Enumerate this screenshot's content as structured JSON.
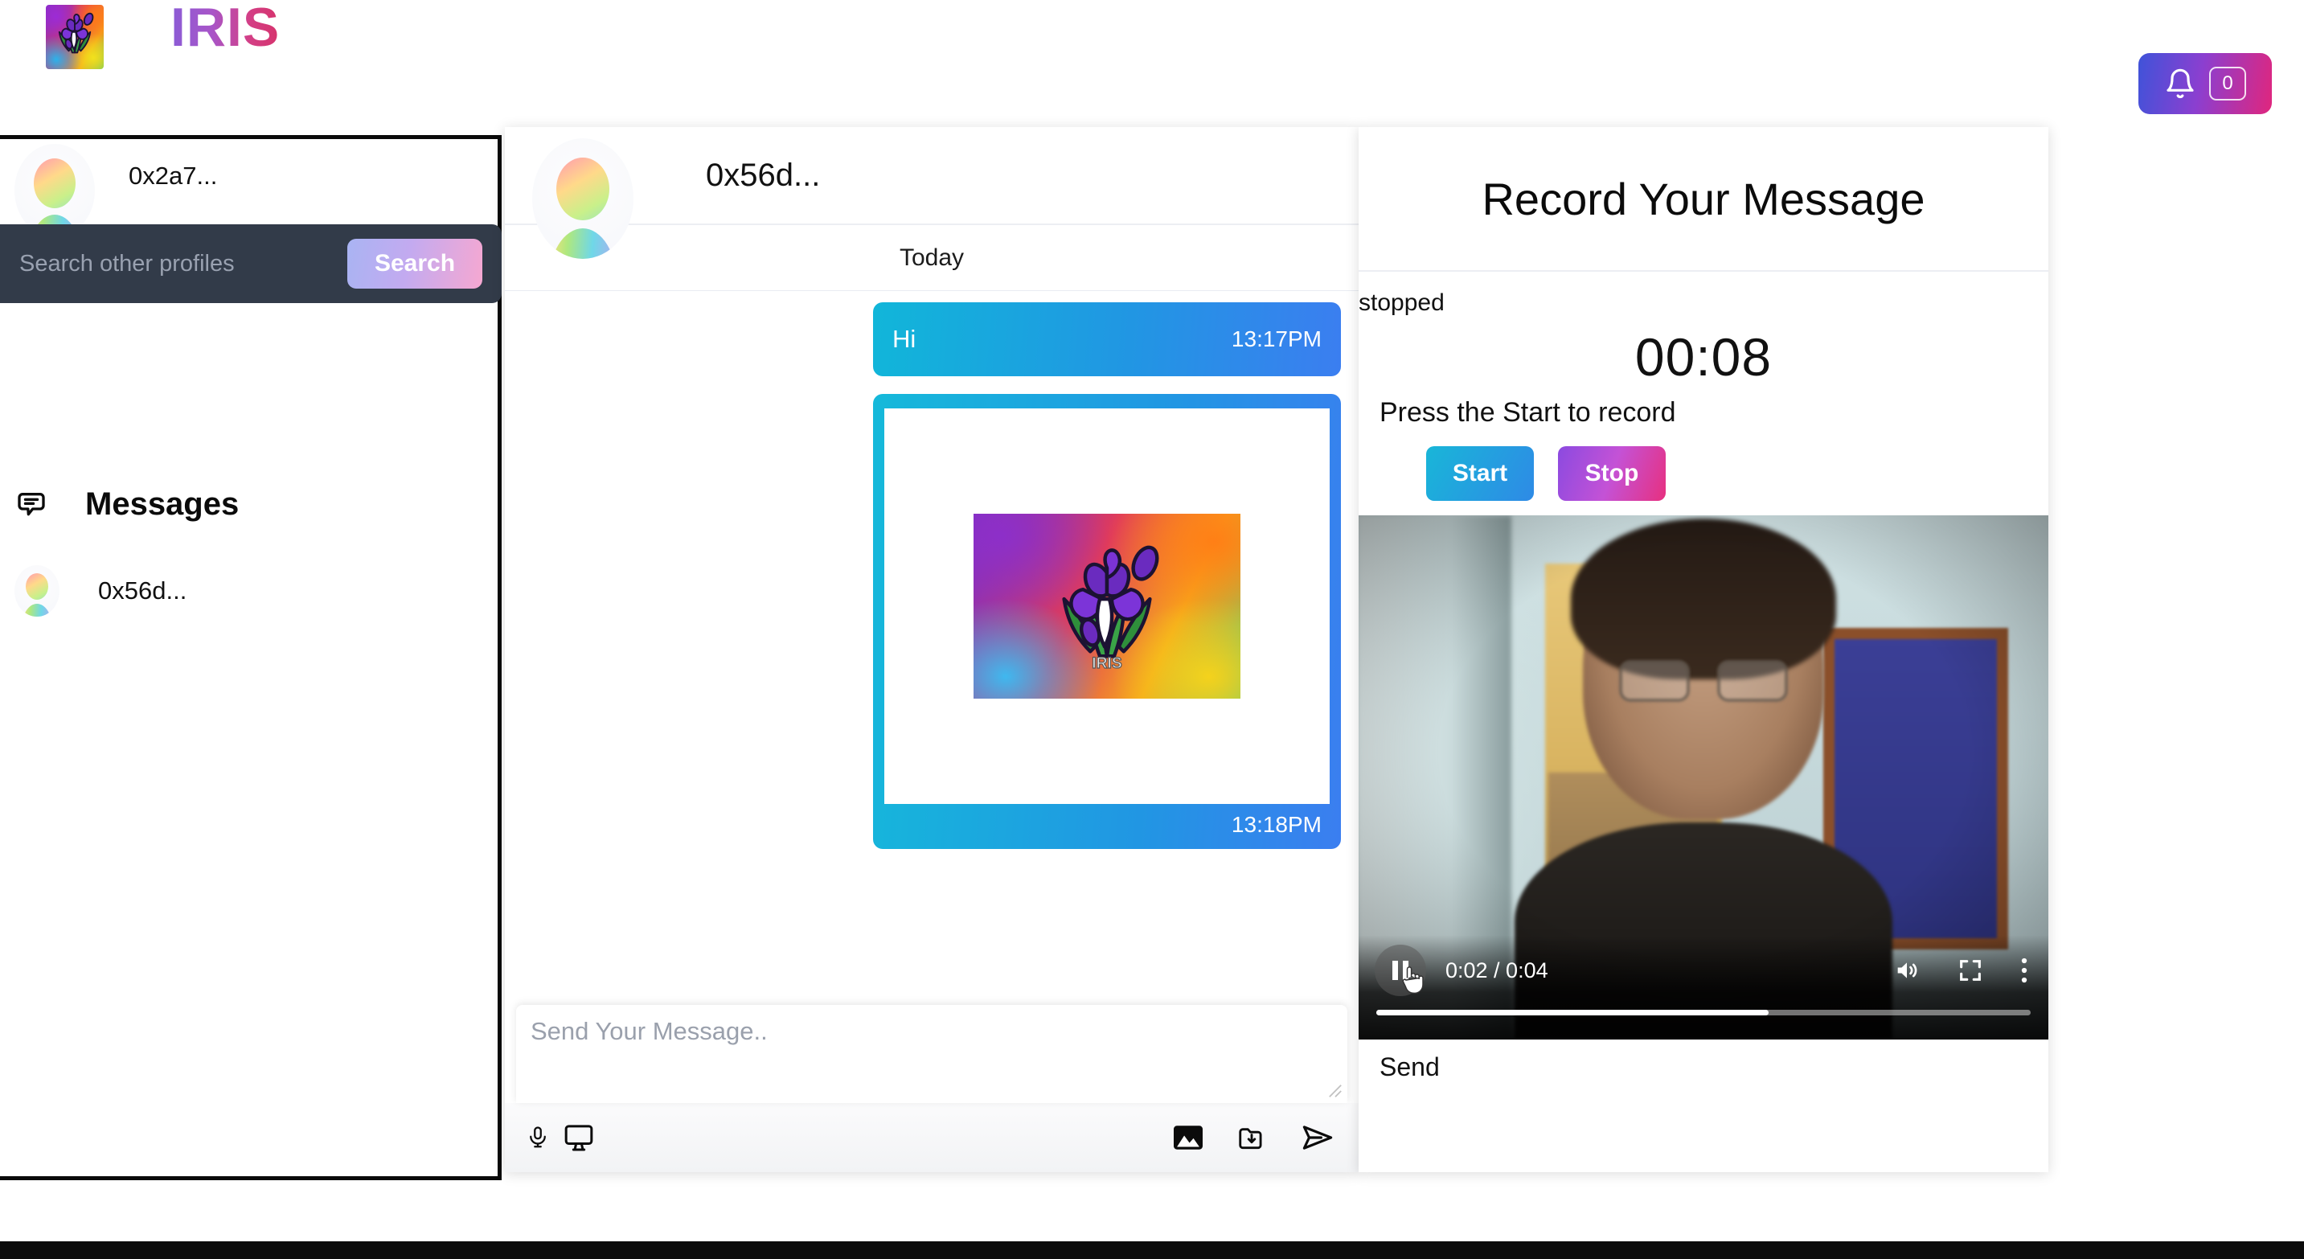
{
  "header": {
    "brand_name": "IRIS",
    "logo_icon": "iris-flower-logo",
    "notification": {
      "bell_icon": "bell-icon",
      "count": "0"
    }
  },
  "sidebar": {
    "profile": {
      "avatar_icon": "user-avatar-gradient",
      "name": "0x2a7..."
    },
    "search": {
      "placeholder": "Search other profiles",
      "value": "",
      "button_label": "Search"
    },
    "messages_section": {
      "icon": "chat-bubble-icon",
      "title": "Messages",
      "threads": [
        {
          "avatar_icon": "user-avatar-gradient",
          "name": "0x56d..."
        }
      ]
    }
  },
  "chat": {
    "header": {
      "avatar_icon": "user-avatar-gradient",
      "title": "0x56d..."
    },
    "day_separator": "Today",
    "messages": [
      {
        "type": "text",
        "body": "Hi",
        "time": "13:17PM"
      },
      {
        "type": "image",
        "image_icon": "iris-flower-image",
        "time": "13:18PM"
      }
    ],
    "composer": {
      "placeholder": "Send Your Message..",
      "value": "",
      "left_tools": [
        {
          "icon": "microphone-icon",
          "name": "record-audio"
        },
        {
          "icon": "monitor-icon",
          "name": "screen-share"
        }
      ],
      "right_tools": [
        {
          "icon": "image-icon",
          "name": "attach-image"
        },
        {
          "icon": "folder-download-icon",
          "name": "attach-file"
        },
        {
          "icon": "send-plane-icon",
          "name": "send-message"
        }
      ]
    }
  },
  "record_panel": {
    "title": "Record Your Message",
    "status": "stopped",
    "timer": "00:08",
    "hint": "Press the Start to record",
    "start_label": "Start",
    "stop_label": "Stop",
    "send_label": "Send",
    "video": {
      "play_state_icon": "pause-icon",
      "current_time": "0:02",
      "duration": "0:04",
      "time_display": "0:02 / 0:04",
      "progress_percent": 60,
      "volume_icon": "volume-icon",
      "fullscreen_icon": "fullscreen-icon",
      "menu_icon": "kebab-menu-icon",
      "cursor_icon": "pointer-hand-cursor"
    }
  },
  "colors": {
    "brand_gradient_start": "#8b5cd6",
    "brand_gradient_end": "#d6336c",
    "notification_gradient_start": "#3f53d9",
    "notification_gradient_end": "#e0267d",
    "search_bar_bg": "#323b49",
    "search_button_start": "#a9b4f3",
    "search_button_end": "#f6a8d1",
    "bubble_gradient_start": "#11b6d9",
    "bubble_gradient_end": "#3b7ef0",
    "start_button_start": "#19b6d8",
    "start_button_end": "#2e8ae6",
    "stop_button_start": "#8b4ae0",
    "stop_button_end": "#e7307f"
  }
}
